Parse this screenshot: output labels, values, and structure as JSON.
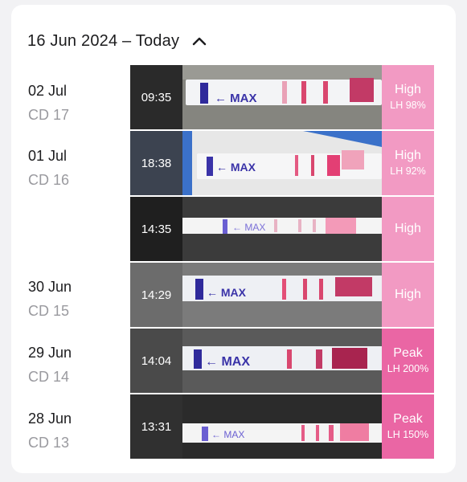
{
  "header": {
    "title": "16 Jun 2024 – Today",
    "toggle_icon": "chevron-up-icon"
  },
  "days": [
    {
      "date": "02 Jul",
      "cycle_day": "CD 17"
    },
    {
      "date": "01 Jul",
      "cycle_day": "CD 16"
    },
    {
      "date": "30 Jun",
      "cycle_day": "CD 15"
    },
    {
      "date": "29 Jun",
      "cycle_day": "CD 14"
    },
    {
      "date": "28 Jun",
      "cycle_day": "CD 13"
    }
  ],
  "tests": [
    {
      "time": "09:35",
      "result": "High",
      "lh": "LH 98%",
      "strip_label": "MAX"
    },
    {
      "time": "18:38",
      "result": "High",
      "lh": "LH 92%",
      "strip_label": "MAX"
    },
    {
      "time": "14:35",
      "result": "High",
      "lh": "",
      "strip_label": "MAX"
    },
    {
      "time": "14:29",
      "result": "High",
      "lh": "",
      "strip_label": "MAX"
    },
    {
      "time": "14:04",
      "result": "Peak",
      "lh": "LH 200%",
      "strip_label": "MAX"
    },
    {
      "time": "13:31",
      "result": "Peak",
      "lh": "LH 150%",
      "strip_label": "MAX"
    }
  ],
  "colors": {
    "high": "#f29ac3",
    "peak": "#ea66a4",
    "line": "#d9476f",
    "strip_text": "#3a33a8"
  }
}
